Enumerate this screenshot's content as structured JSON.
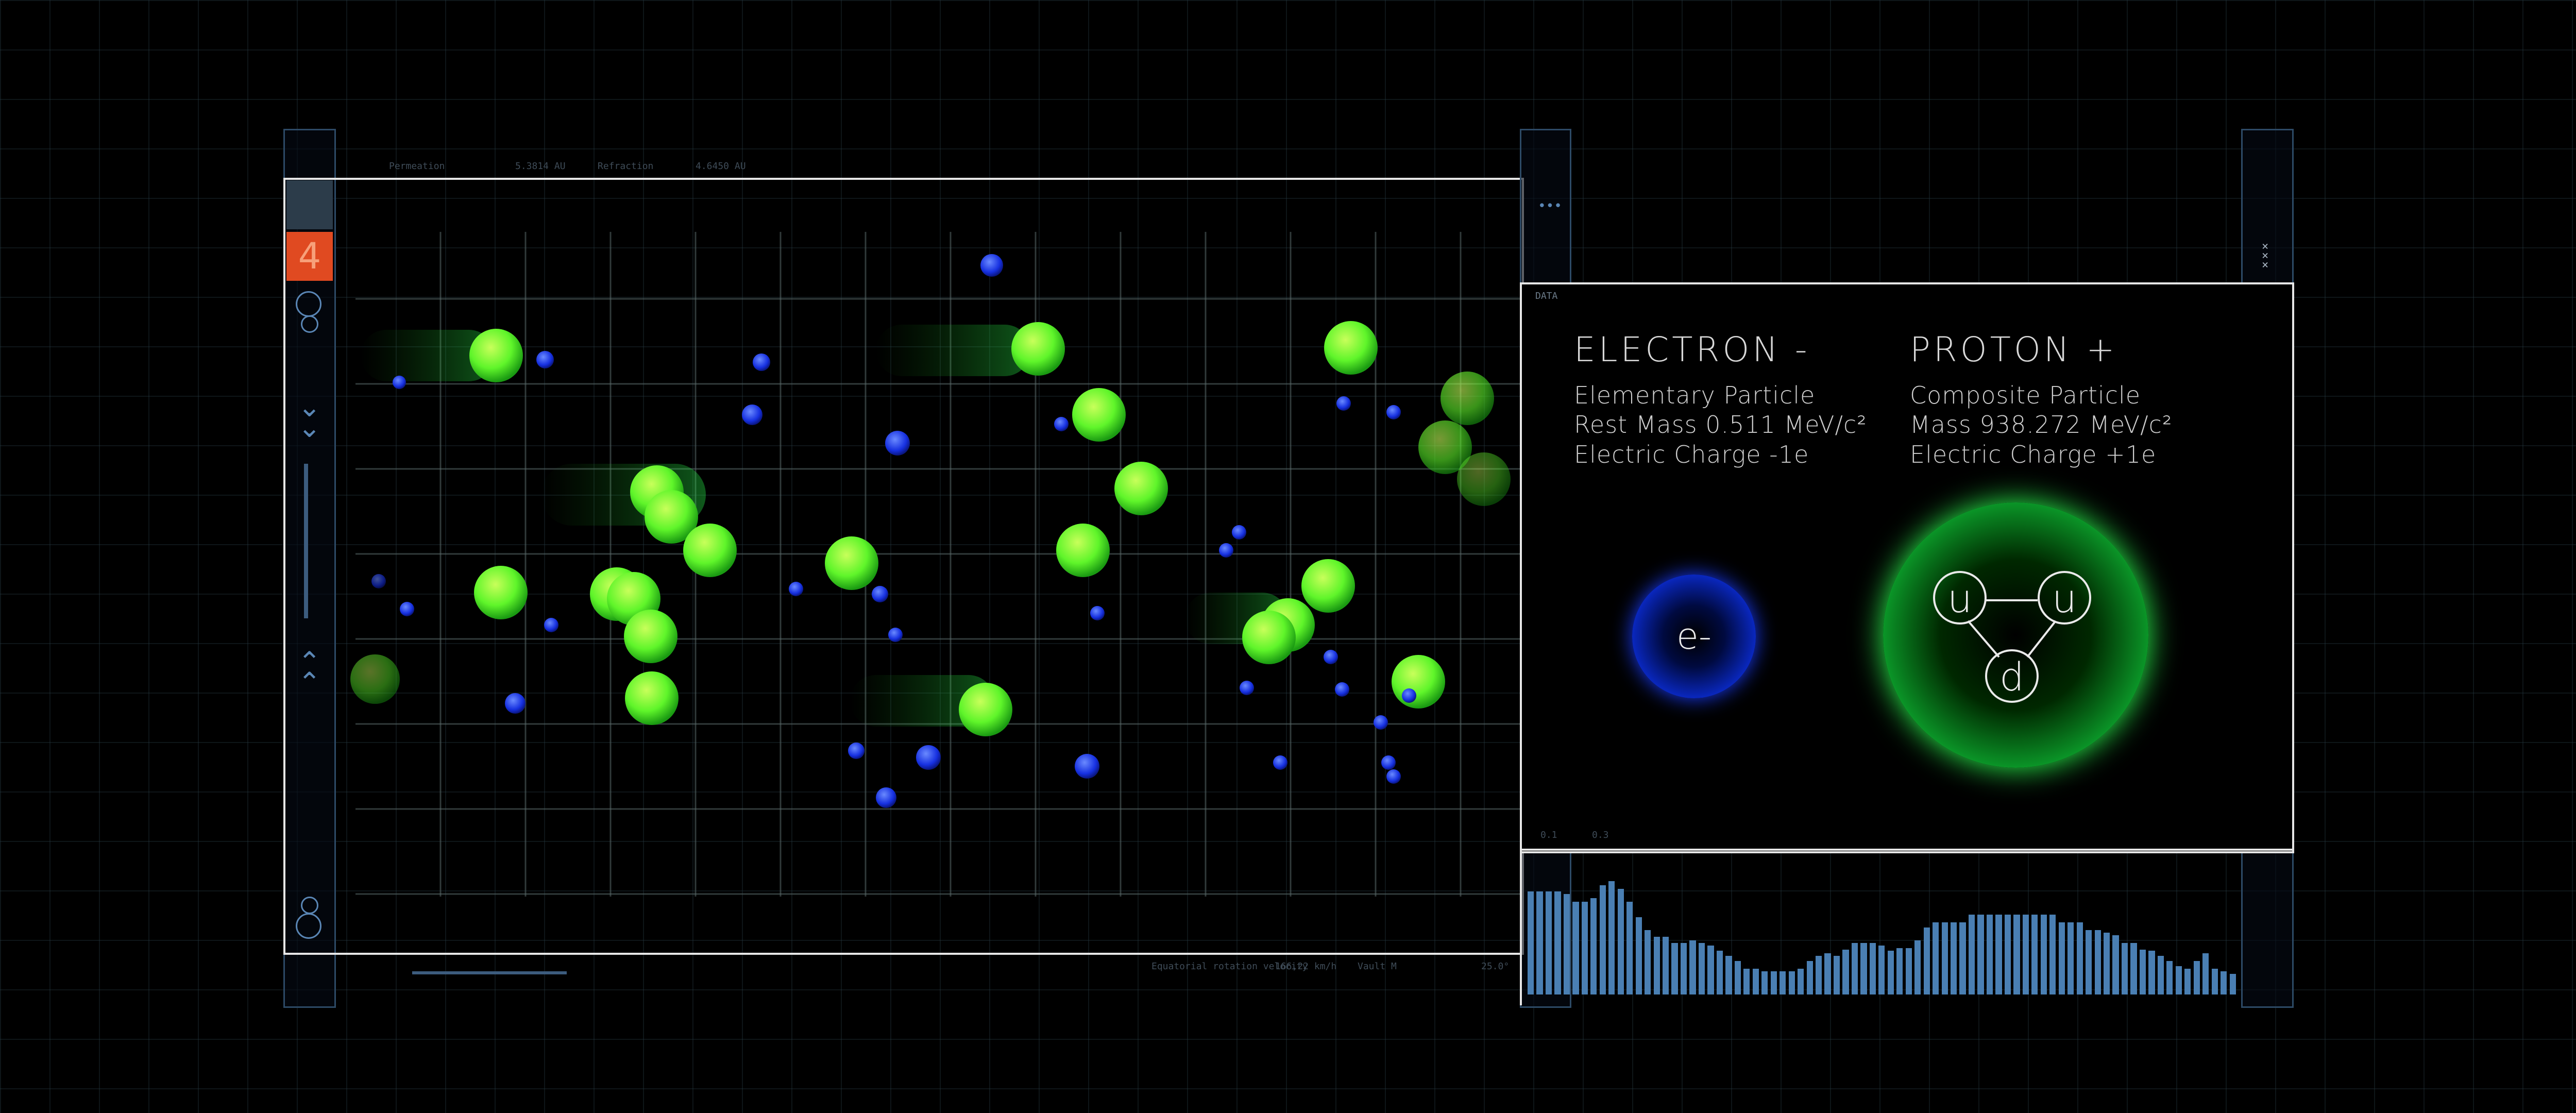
{
  "top_readout": {
    "label1": "Permeation",
    "value1": "5.3814 AU",
    "label2": "Refraction",
    "value2": "4.6450 AU"
  },
  "bottom_readout": {
    "label": "Equatorial rotation velocity",
    "value": "166,22 km/h",
    "label2": "Vault M",
    "value2": "25.0°"
  },
  "sidebar": {
    "badge_number": "4"
  },
  "data_panel": {
    "header": "DATA",
    "bottom_ticks": [
      "0.1",
      "0.3"
    ],
    "electron": {
      "title": "ELECTRON -",
      "line1": "Elementary Particle",
      "line2": "Rest Mass 0.511 MeV/c²",
      "line3": "Electric Charge -1e",
      "symbol": "e-",
      "color": "#1a3cff"
    },
    "proton": {
      "title": "PROTON +",
      "line1": "Composite Particle",
      "line2": "Mass 938.272 MeV/c²",
      "line3": "Electric Charge +1e",
      "quarks": [
        "u",
        "u",
        "d"
      ],
      "color": "#2cff50"
    }
  },
  "histogram": {
    "values": [
      0.8,
      0.8,
      0.8,
      0.8,
      0.78,
      0.72,
      0.72,
      0.75,
      0.85,
      0.88,
      0.82,
      0.72,
      0.6,
      0.5,
      0.45,
      0.45,
      0.4,
      0.4,
      0.42,
      0.4,
      0.38,
      0.34,
      0.3,
      0.26,
      0.2,
      0.2,
      0.18,
      0.18,
      0.18,
      0.18,
      0.2,
      0.26,
      0.3,
      0.32,
      0.3,
      0.35,
      0.4,
      0.4,
      0.4,
      0.38,
      0.34,
      0.36,
      0.36,
      0.42,
      0.52,
      0.56,
      0.56,
      0.56,
      0.56,
      0.62,
      0.62,
      0.62,
      0.62,
      0.62,
      0.62,
      0.62,
      0.62,
      0.62,
      0.62,
      0.56,
      0.56,
      0.56,
      0.5,
      0.5,
      0.48,
      0.46,
      0.4,
      0.4,
      0.35,
      0.34,
      0.3,
      0.26,
      0.22,
      0.2,
      0.26,
      0.32,
      0.2,
      0.18,
      0.16
    ],
    "color": "#4a7fb3"
  },
  "particles": {
    "proton_color": "#5ff52a",
    "electron_color": "#1630e0"
  }
}
